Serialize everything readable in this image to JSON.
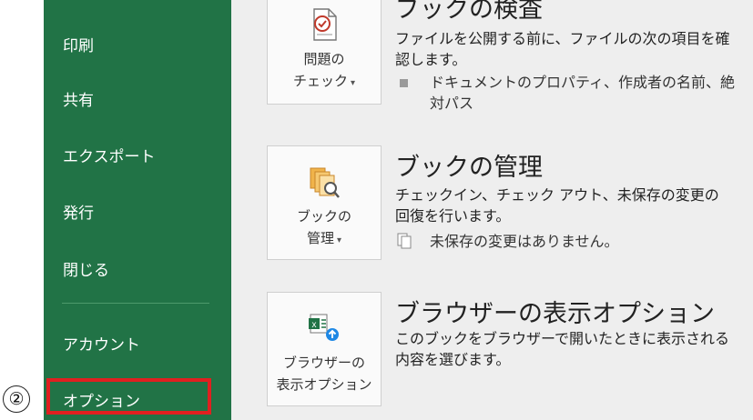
{
  "step_marker": "②",
  "sidebar": {
    "items": [
      {
        "label": "印刷"
      },
      {
        "label": "共有"
      },
      {
        "label": "エクスポート"
      },
      {
        "label": "発行"
      },
      {
        "label": "閉じる"
      },
      {
        "label": "アカウント"
      },
      {
        "label": "オプション"
      }
    ],
    "highlight_color": "#e02020",
    "background_color": "#217346"
  },
  "sections": [
    {
      "title": "ブックの検査",
      "tile_line1": "問題の",
      "tile_line2": "チェック",
      "description": "ファイルを公開する前に、ファイルの次の項目を確認します。",
      "bullet": "ドキュメントのプロパティ、作成者の名前、絶対パス",
      "icon": "inspect-document-icon"
    },
    {
      "title": "ブックの管理",
      "tile_line1": "ブックの",
      "tile_line2": "管理",
      "description": "チェックイン、チェック アウト、未保存の変更の回復を行います。",
      "bullet": "未保存の変更はありません。",
      "icon": "manage-workbook-icon"
    },
    {
      "title": "ブラウザーの表示オプション",
      "tile_line1": "ブラウザーの",
      "tile_line2": "表示オプション",
      "description": "このブックをブラウザーで開いたときに表示される内容を選びます。",
      "icon": "browser-view-options-icon"
    }
  ]
}
